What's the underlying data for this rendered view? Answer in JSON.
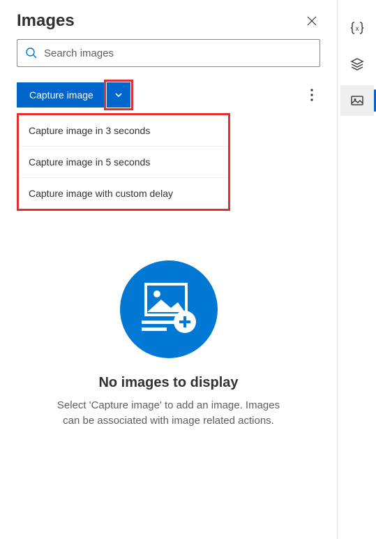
{
  "header": {
    "title": "Images"
  },
  "search": {
    "placeholder": "Search images"
  },
  "toolbar": {
    "capture_label": "Capture image"
  },
  "dropdown": {
    "items": [
      {
        "label": "Capture image in 3 seconds"
      },
      {
        "label": "Capture image in 5 seconds"
      },
      {
        "label": "Capture image with custom delay"
      }
    ]
  },
  "empty": {
    "title": "No images to display",
    "description": "Select 'Capture image' to add an image. Images can be associated with image related actions."
  }
}
